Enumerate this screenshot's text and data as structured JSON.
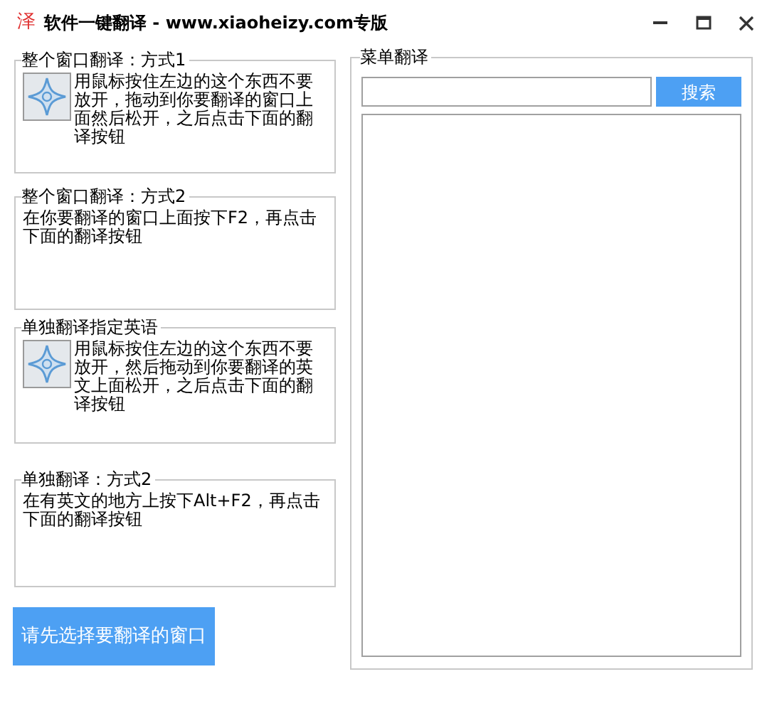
{
  "window": {
    "icon_char": "泽",
    "title": "软件一键翻译 - www.xiaoheizy.com专版"
  },
  "left_groups": [
    {
      "kind": "drag",
      "title": "整个窗口翻译：方式1",
      "text": "用鼠标按住左边的这个东西不要放开，拖动到你要翻译的窗口上面然后松开，之后点击下面的翻译按钮"
    },
    {
      "kind": "text",
      "title": "整个窗口翻译：方式2",
      "text": "在你要翻译的窗口上面按下F2，再点击下面的翻译按钮"
    },
    {
      "kind": "drag",
      "title": "单独翻译指定英语",
      "text": "用鼠标按住左边的这个东西不要放开，然后拖动到你要翻译的英文上面松开，之后点击下面的翻译按钮"
    },
    {
      "kind": "text",
      "title": "单独翻译：方式2",
      "text": "在有英文的地方上按下Alt+F2，再点击下面的翻译按钮"
    }
  ],
  "translate_button": "请先选择要翻译的窗口",
  "menu_group": {
    "title": "菜单翻译",
    "search_button": "搜索"
  }
}
